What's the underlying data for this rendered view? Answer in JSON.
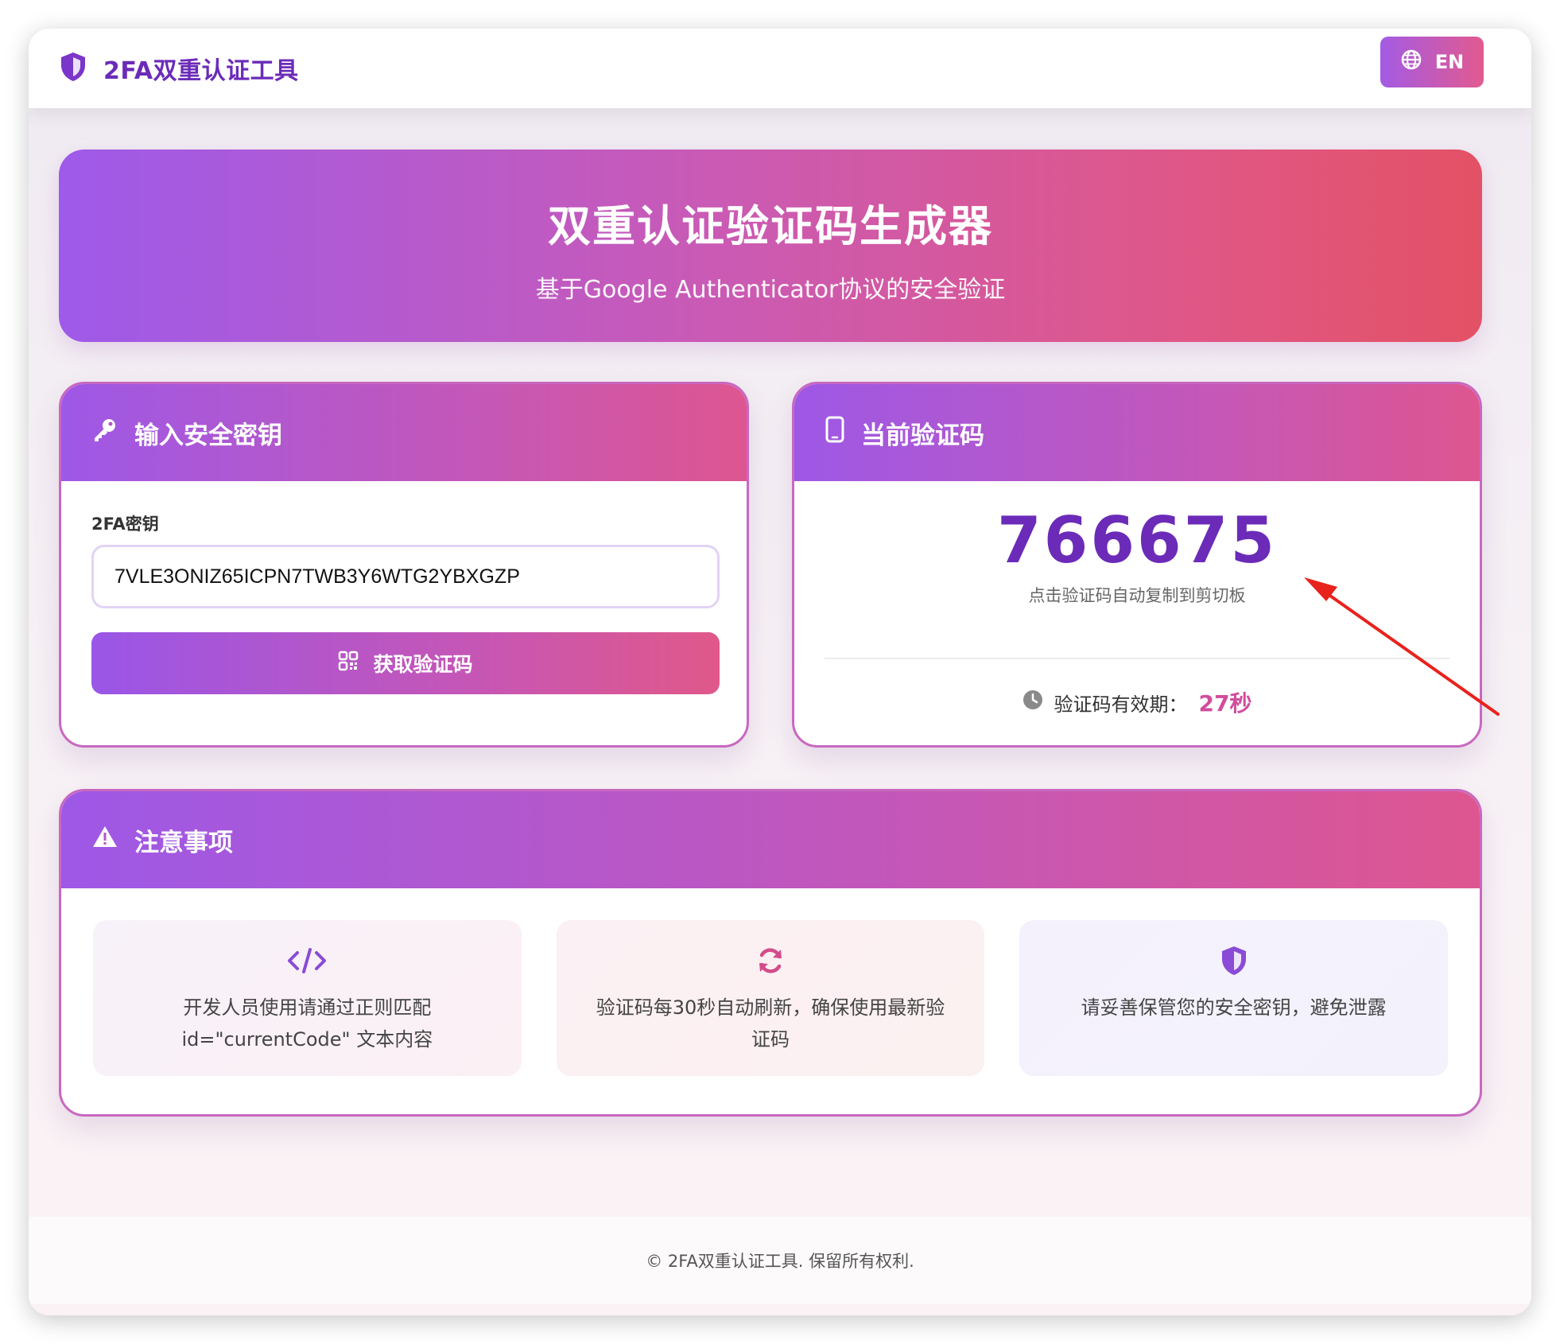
{
  "header": {
    "app_title": "2FA双重认证工具",
    "lang_button_label": "EN"
  },
  "hero": {
    "title": "双重认证验证码生成器",
    "subtitle": "基于Google Authenticator协议的安全验证"
  },
  "input_card": {
    "title": "输入安全密钥",
    "field_label": "2FA密钥",
    "secret_value": "7VLE3ONIZ65ICPN7TWB3Y6WTG2YBXGZP",
    "button_label": "获取验证码"
  },
  "code_card": {
    "title": "当前验证码",
    "code": "766675",
    "hint": "点击验证码自动复制到剪切板",
    "validity_label": "验证码有效期：",
    "validity_value": "27秒"
  },
  "notes_card": {
    "title": "注意事项",
    "items": [
      {
        "icon": "code-icon",
        "line1": "开发人员使用请通过正则匹配",
        "line2": "id=\"currentCode\" 文本内容"
      },
      {
        "icon": "refresh-icon",
        "line1": "验证码每30秒自动刷新，确保使用最新验",
        "line2": "证码"
      },
      {
        "icon": "shield-icon",
        "line1": "请妥善保管您的安全密钥，避免泄露",
        "line2": ""
      }
    ]
  },
  "footer": {
    "text": "© 2FA双重认证工具. 保留所有权利."
  },
  "colors": {
    "brand_purple": "#6b2bb8",
    "gradient_start": "#9e58e6",
    "gradient_end": "#e35165",
    "validity_accent": "#d24c9c",
    "annotation_arrow": "#e8221c"
  }
}
